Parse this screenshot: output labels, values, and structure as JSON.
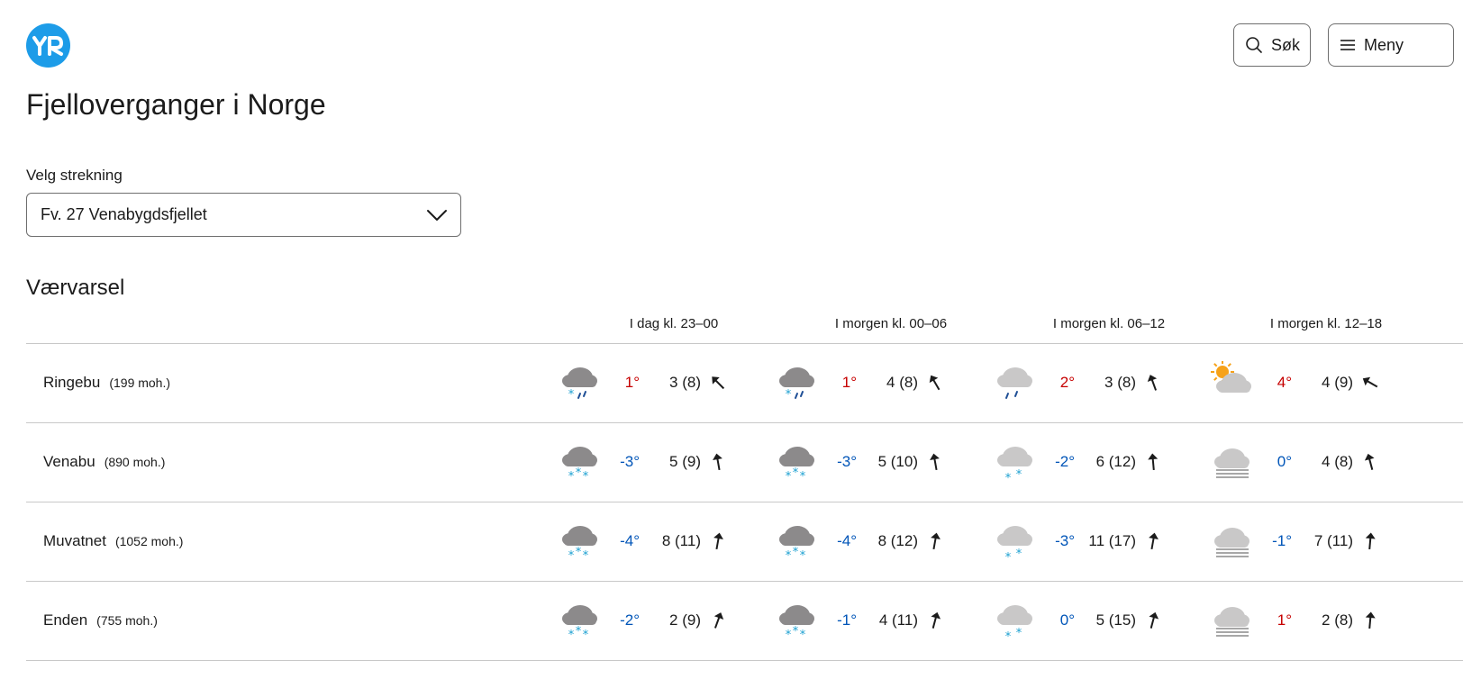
{
  "header": {
    "logo_text": "YR",
    "search_label": "Søk",
    "menu_label": "Meny",
    "brand_color": "#1d9ce8"
  },
  "page_title": "Fjelloverganger i Norge",
  "route_select": {
    "label": "Velg strekning",
    "value": "Fv. 27 Venabygdsfjellet"
  },
  "forecast": {
    "title": "Værvarsel",
    "periods": [
      "I dag kl. 23–00",
      "I morgen kl. 00–06",
      "I morgen kl. 06–12",
      "I morgen kl. 12–18"
    ],
    "rows": [
      {
        "name": "Ringebu",
        "altitude": "(199 moh.)",
        "cells": [
          {
            "icon": "sleet",
            "temp": "1°",
            "wind": "3 (8)",
            "dir": 315
          },
          {
            "icon": "sleet",
            "temp": "1°",
            "wind": "4 (8)",
            "dir": 330
          },
          {
            "icon": "rain",
            "temp": "2°",
            "wind": "3 (8)",
            "dir": 340
          },
          {
            "icon": "partly-cloudy",
            "temp": "4°",
            "wind": "4 (9)",
            "dir": 300
          }
        ]
      },
      {
        "name": "Venabu",
        "altitude": "(890 moh.)",
        "cells": [
          {
            "icon": "snow",
            "temp": "-3°",
            "wind": "5 (9)",
            "dir": 350
          },
          {
            "icon": "snow",
            "temp": "-3°",
            "wind": "5 (10)",
            "dir": 350
          },
          {
            "icon": "light-snow",
            "temp": "-2°",
            "wind": "6 (12)",
            "dir": 355
          },
          {
            "icon": "fog",
            "temp": "0°",
            "wind": "4 (8)",
            "dir": 345
          }
        ]
      },
      {
        "name": "Muvatnet",
        "altitude": "(1052 moh.)",
        "cells": [
          {
            "icon": "snow",
            "temp": "-4°",
            "wind": "8 (11)",
            "dir": 10
          },
          {
            "icon": "snow",
            "temp": "-4°",
            "wind": "8 (12)",
            "dir": 10
          },
          {
            "icon": "light-snow",
            "temp": "-3°",
            "wind": "11 (17)",
            "dir": 10
          },
          {
            "icon": "fog",
            "temp": "-1°",
            "wind": "7 (11)",
            "dir": 5
          }
        ]
      },
      {
        "name": "Enden",
        "altitude": "(755 moh.)",
        "cells": [
          {
            "icon": "snow",
            "temp": "-2°",
            "wind": "2 (9)",
            "dir": 20
          },
          {
            "icon": "snow",
            "temp": "-1°",
            "wind": "4 (11)",
            "dir": 15
          },
          {
            "icon": "light-snow",
            "temp": "0°",
            "wind": "5 (15)",
            "dir": 15
          },
          {
            "icon": "fog",
            "temp": "1°",
            "wind": "2 (8)",
            "dir": 5
          }
        ]
      }
    ]
  },
  "colors": {
    "temp_warm": "#c60000",
    "temp_cold": "#0055b8",
    "snow_flake": "#1a9fd0",
    "rain_drop": "#1f4f96",
    "sun": "#f6a21a",
    "cloud_dark": "#8c8a8b",
    "cloud_light": "#c9c8c8"
  }
}
